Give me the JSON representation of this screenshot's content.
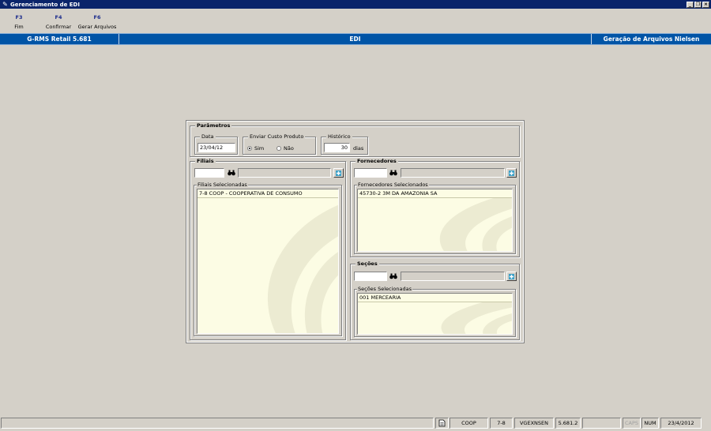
{
  "window": {
    "title": "Gerenciamento de EDI"
  },
  "toolbar": [
    {
      "key": "F3",
      "label": "Fim"
    },
    {
      "key": "F4",
      "label": "Confirmar"
    },
    {
      "key": "F6",
      "label": "Gerar Arquivos"
    }
  ],
  "header": {
    "left": "G-RMS Retail 5.681",
    "center": "EDI",
    "right": "Geração de Arquivos Nielsen"
  },
  "parametros": {
    "title": "Parâmetros",
    "data_label": "Data",
    "data_value": "23/04/12",
    "enviar_label": "Enviar Custo Produto",
    "sim_label": "Sim",
    "nao_label": "Não",
    "sim_selected": true,
    "historico_label": "Histórico",
    "historico_value": "30",
    "dias_label": "dias"
  },
  "filiais": {
    "title": "Filiais",
    "code_value": "",
    "desc_value": "",
    "list_label": "Filiais Selecionadas",
    "items": [
      "7-8 COOP - COOPERATIVA DE CONSUMO"
    ]
  },
  "fornecedores": {
    "title": "Fornecedores",
    "code_value": "",
    "desc_value": "",
    "list_label": "Fornecedores Selecionados",
    "items": [
      "45730-2 3M DA AMAZONIA SA"
    ]
  },
  "secoes": {
    "title": "Seções",
    "code_value": "",
    "desc_value": "",
    "list_label": "Seções Selecionadas",
    "items": [
      "001 MERCEARIA"
    ]
  },
  "statusbar": {
    "company": "COOP",
    "branch": "7-8",
    "program": "VGEXNSEN",
    "version": "5.681.2",
    "caps": "CAPS",
    "num": "NUM",
    "date": "23/4/2012"
  },
  "icons": {
    "window": "edi-app-icon",
    "search": "binoculars-icon",
    "add": "add-list-icon",
    "status_doc": "document-icon"
  }
}
